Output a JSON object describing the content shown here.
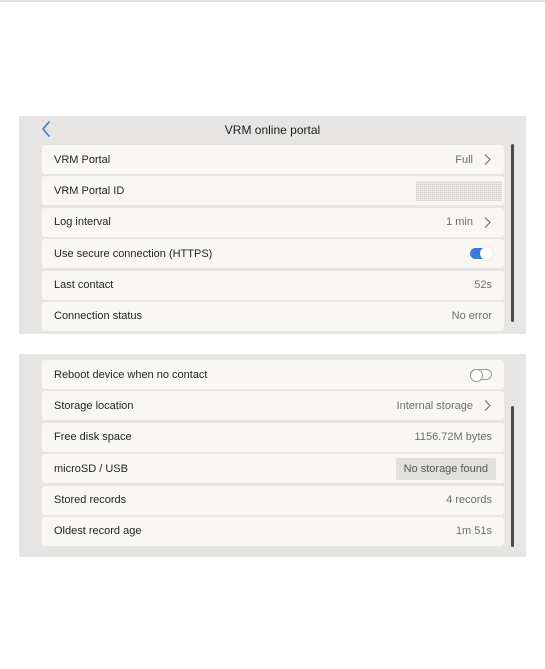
{
  "portal_panel": {
    "title": "VRM online portal",
    "rows": [
      {
        "label": "VRM Portal",
        "value": "Full"
      },
      {
        "label": "VRM Portal ID",
        "value": ""
      },
      {
        "label": "Log interval",
        "value": "1 min"
      },
      {
        "label": "Use secure connection (HTTPS)",
        "toggle": "on"
      },
      {
        "label": "Last contact",
        "value": "52s"
      },
      {
        "label": "Connection status",
        "value": "No error"
      }
    ]
  },
  "storage_panel": {
    "rows": [
      {
        "label": "Reboot device when no contact",
        "toggle": "off"
      },
      {
        "label": "Storage location",
        "value": "Internal storage"
      },
      {
        "label": "Free disk space",
        "value": "1156.72M bytes"
      },
      {
        "label": "microSD / USB",
        "value": "No storage found"
      },
      {
        "label": "Stored records",
        "value": "4 records"
      },
      {
        "label": "Oldest record age",
        "value": "1m 51s"
      }
    ]
  },
  "colors": {
    "accent": "#3a7bd5",
    "panel_bg": "#e6e5e3",
    "row_bg": "#f8f7f4"
  },
  "icons": [
    "back-chevron-icon",
    "chevron-right-icon",
    "toggle-switch"
  ]
}
